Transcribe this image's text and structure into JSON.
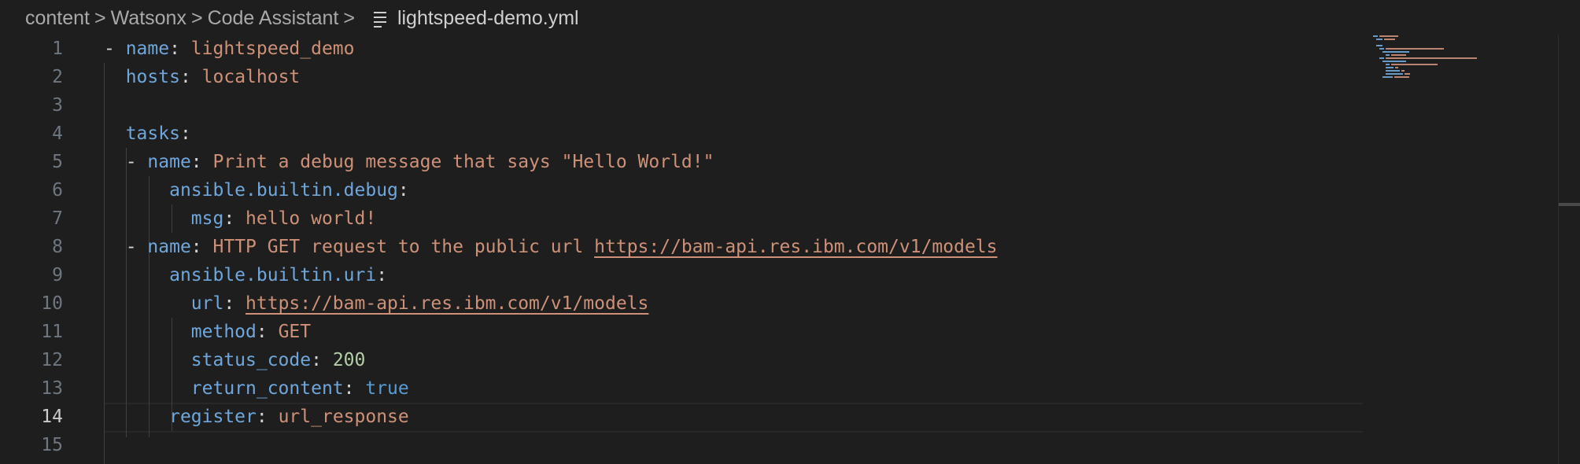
{
  "breadcrumb": {
    "items": [
      "content",
      "Watsonx",
      "Code Assistant"
    ],
    "file": "lightspeed-demo.yml",
    "separator": ">"
  },
  "editor": {
    "active_line": 14,
    "line_numbers": [
      "1",
      "2",
      "3",
      "4",
      "5",
      "6",
      "7",
      "8",
      "9",
      "10",
      "11",
      "12",
      "13",
      "14",
      "15"
    ],
    "lines": [
      {
        "dash": "- ",
        "key": "name",
        "colon": ": ",
        "value": "lightspeed_demo",
        "vtype": "s"
      },
      {
        "key": "hosts",
        "colon": ": ",
        "value": "localhost",
        "vtype": "s"
      },
      {},
      {
        "key": "tasks",
        "colon": ":"
      },
      {
        "dash": "- ",
        "key": "name",
        "colon": ": ",
        "value": "Print a debug message that says \"Hello World!\"",
        "vtype": "s"
      },
      {
        "key": "ansible.builtin.debug",
        "colon": ":"
      },
      {
        "key": "msg",
        "colon": ": ",
        "value": "hello world!",
        "vtype": "s"
      },
      {
        "dash": "- ",
        "key": "name",
        "colon": ": ",
        "value": "HTTP GET request to the public url ",
        "vtype": "s",
        "link": "https://bam-api.res.ibm.com/v1/models"
      },
      {
        "key": "ansible.builtin.uri",
        "colon": ":"
      },
      {
        "key": "url",
        "colon": ": ",
        "link": "https://bam-api.res.ibm.com/v1/models"
      },
      {
        "key": "method",
        "colon": ": ",
        "value": "GET",
        "vtype": "s"
      },
      {
        "key": "status_code",
        "colon": ": ",
        "value": "200",
        "vtype": "n"
      },
      {
        "key": "return_content",
        "colon": ": ",
        "value": "true",
        "vtype": "b"
      },
      {
        "key": "register",
        "colon": ": ",
        "value": "url_response",
        "vtype": "s"
      },
      {}
    ]
  },
  "colors": {
    "background": "#1e1e1e",
    "key": "#6fa7dc",
    "string": "#ce9178",
    "number": "#b5cea8",
    "boolean": "#569cd6",
    "line_number": "#6e7681",
    "line_number_active": "#cccccc"
  },
  "icons": {
    "file": "file-lines-icon",
    "separator": "chevron-right-icon"
  }
}
